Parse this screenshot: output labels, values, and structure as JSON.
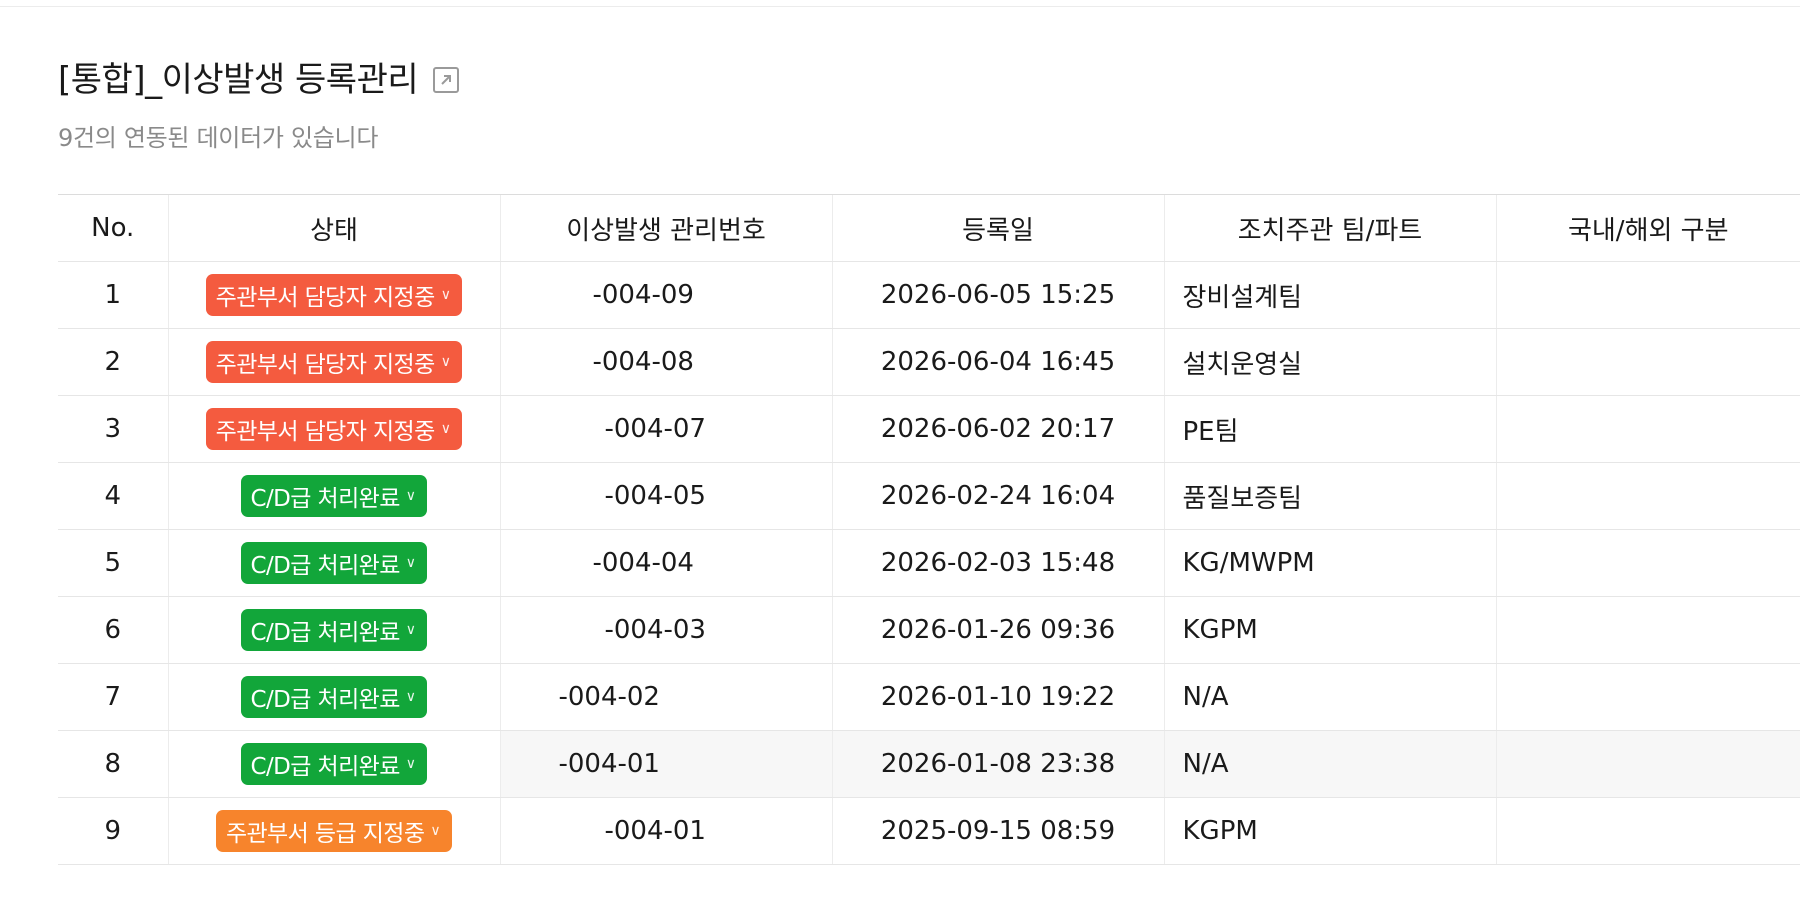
{
  "header": {
    "title": "[통합]_이상발생 등록관리",
    "subtitle": "9건의 연동된 데이터가 있습니다",
    "external_icon": "external-link-icon"
  },
  "table": {
    "columns": [
      "No.",
      "상태",
      "이상발생 관리번호",
      "등록일",
      "조치주관 팀/파트",
      "국내/해외 구분"
    ],
    "rows": [
      {
        "no": "1",
        "status": "주관부서 담당자 지정중",
        "status_color": "#f45b3f",
        "id": "-004-09",
        "date": "2026-06-05 15:25",
        "team": "장비설계팀",
        "region": ""
      },
      {
        "no": "2",
        "status": "주관부서 담당자 지정중",
        "status_color": "#f45b3f",
        "id": "-004-08",
        "date": "2026-06-04 16:45",
        "team": "설치운영실",
        "region": ""
      },
      {
        "no": "3",
        "status": "주관부서 담당자 지정중",
        "status_color": "#f45b3f",
        "id": "-004-07",
        "date": "2026-06-02 20:17",
        "team": "PE팀",
        "region": ""
      },
      {
        "no": "4",
        "status": "C/D급 처리완료",
        "status_color": "#12a63a",
        "id": "-004-05",
        "date": "2026-02-24 16:04",
        "team": "품질보증팀",
        "region": ""
      },
      {
        "no": "5",
        "status": "C/D급 처리완료",
        "status_color": "#12a63a",
        "id": "-004-04",
        "date": "2026-02-03 15:48",
        "team": "KG/MWPM",
        "region": ""
      },
      {
        "no": "6",
        "status": "C/D급 처리완료",
        "status_color": "#12a63a",
        "id": "-004-03",
        "date": "2026-01-26 09:36",
        "team": "KGPM",
        "region": ""
      },
      {
        "no": "7",
        "status": "C/D급 처리완료",
        "status_color": "#12a63a",
        "id": "-004-02",
        "date": "2026-01-10 19:22",
        "team": "N/A",
        "region": ""
      },
      {
        "no": "8",
        "status": "C/D급 처리완료",
        "status_color": "#12a63a",
        "id": "-004-01",
        "date": "2026-01-08 23:38",
        "team": "N/A",
        "region": ""
      },
      {
        "no": "9",
        "status": "주관부서 등급 지정중",
        "status_color": "#f7842c",
        "id": "-004-01",
        "date": "2025-09-15 08:59",
        "team": "KGPM",
        "region": ""
      }
    ]
  },
  "icons": {
    "status_dropdown": "chevron-down-icon"
  }
}
